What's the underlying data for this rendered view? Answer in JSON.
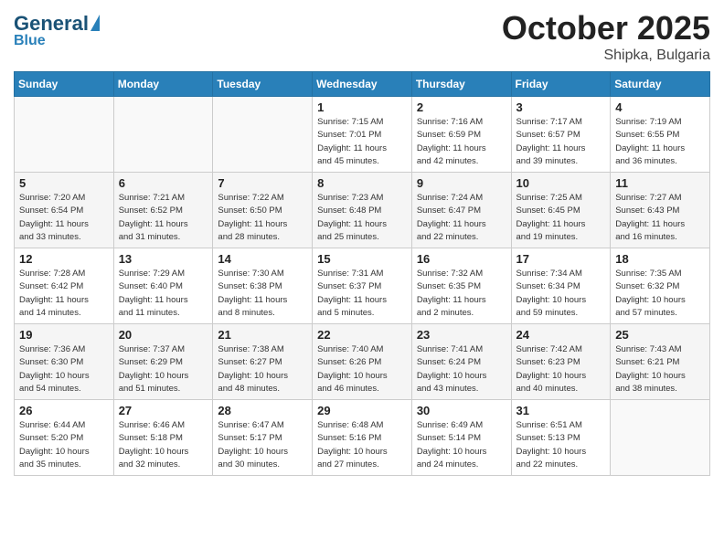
{
  "header": {
    "logo_general": "General",
    "logo_blue": "Blue",
    "month_title": "October 2025",
    "subtitle": "Shipka, Bulgaria"
  },
  "days_of_week": [
    "Sunday",
    "Monday",
    "Tuesday",
    "Wednesday",
    "Thursday",
    "Friday",
    "Saturday"
  ],
  "weeks": [
    [
      {
        "day": "",
        "info": ""
      },
      {
        "day": "",
        "info": ""
      },
      {
        "day": "",
        "info": ""
      },
      {
        "day": "1",
        "info": "Sunrise: 7:15 AM\nSunset: 7:01 PM\nDaylight: 11 hours\nand 45 minutes."
      },
      {
        "day": "2",
        "info": "Sunrise: 7:16 AM\nSunset: 6:59 PM\nDaylight: 11 hours\nand 42 minutes."
      },
      {
        "day": "3",
        "info": "Sunrise: 7:17 AM\nSunset: 6:57 PM\nDaylight: 11 hours\nand 39 minutes."
      },
      {
        "day": "4",
        "info": "Sunrise: 7:19 AM\nSunset: 6:55 PM\nDaylight: 11 hours\nand 36 minutes."
      }
    ],
    [
      {
        "day": "5",
        "info": "Sunrise: 7:20 AM\nSunset: 6:54 PM\nDaylight: 11 hours\nand 33 minutes."
      },
      {
        "day": "6",
        "info": "Sunrise: 7:21 AM\nSunset: 6:52 PM\nDaylight: 11 hours\nand 31 minutes."
      },
      {
        "day": "7",
        "info": "Sunrise: 7:22 AM\nSunset: 6:50 PM\nDaylight: 11 hours\nand 28 minutes."
      },
      {
        "day": "8",
        "info": "Sunrise: 7:23 AM\nSunset: 6:48 PM\nDaylight: 11 hours\nand 25 minutes."
      },
      {
        "day": "9",
        "info": "Sunrise: 7:24 AM\nSunset: 6:47 PM\nDaylight: 11 hours\nand 22 minutes."
      },
      {
        "day": "10",
        "info": "Sunrise: 7:25 AM\nSunset: 6:45 PM\nDaylight: 11 hours\nand 19 minutes."
      },
      {
        "day": "11",
        "info": "Sunrise: 7:27 AM\nSunset: 6:43 PM\nDaylight: 11 hours\nand 16 minutes."
      }
    ],
    [
      {
        "day": "12",
        "info": "Sunrise: 7:28 AM\nSunset: 6:42 PM\nDaylight: 11 hours\nand 14 minutes."
      },
      {
        "day": "13",
        "info": "Sunrise: 7:29 AM\nSunset: 6:40 PM\nDaylight: 11 hours\nand 11 minutes."
      },
      {
        "day": "14",
        "info": "Sunrise: 7:30 AM\nSunset: 6:38 PM\nDaylight: 11 hours\nand 8 minutes."
      },
      {
        "day": "15",
        "info": "Sunrise: 7:31 AM\nSunset: 6:37 PM\nDaylight: 11 hours\nand 5 minutes."
      },
      {
        "day": "16",
        "info": "Sunrise: 7:32 AM\nSunset: 6:35 PM\nDaylight: 11 hours\nand 2 minutes."
      },
      {
        "day": "17",
        "info": "Sunrise: 7:34 AM\nSunset: 6:34 PM\nDaylight: 10 hours\nand 59 minutes."
      },
      {
        "day": "18",
        "info": "Sunrise: 7:35 AM\nSunset: 6:32 PM\nDaylight: 10 hours\nand 57 minutes."
      }
    ],
    [
      {
        "day": "19",
        "info": "Sunrise: 7:36 AM\nSunset: 6:30 PM\nDaylight: 10 hours\nand 54 minutes."
      },
      {
        "day": "20",
        "info": "Sunrise: 7:37 AM\nSunset: 6:29 PM\nDaylight: 10 hours\nand 51 minutes."
      },
      {
        "day": "21",
        "info": "Sunrise: 7:38 AM\nSunset: 6:27 PM\nDaylight: 10 hours\nand 48 minutes."
      },
      {
        "day": "22",
        "info": "Sunrise: 7:40 AM\nSunset: 6:26 PM\nDaylight: 10 hours\nand 46 minutes."
      },
      {
        "day": "23",
        "info": "Sunrise: 7:41 AM\nSunset: 6:24 PM\nDaylight: 10 hours\nand 43 minutes."
      },
      {
        "day": "24",
        "info": "Sunrise: 7:42 AM\nSunset: 6:23 PM\nDaylight: 10 hours\nand 40 minutes."
      },
      {
        "day": "25",
        "info": "Sunrise: 7:43 AM\nSunset: 6:21 PM\nDaylight: 10 hours\nand 38 minutes."
      }
    ],
    [
      {
        "day": "26",
        "info": "Sunrise: 6:44 AM\nSunset: 5:20 PM\nDaylight: 10 hours\nand 35 minutes."
      },
      {
        "day": "27",
        "info": "Sunrise: 6:46 AM\nSunset: 5:18 PM\nDaylight: 10 hours\nand 32 minutes."
      },
      {
        "day": "28",
        "info": "Sunrise: 6:47 AM\nSunset: 5:17 PM\nDaylight: 10 hours\nand 30 minutes."
      },
      {
        "day": "29",
        "info": "Sunrise: 6:48 AM\nSunset: 5:16 PM\nDaylight: 10 hours\nand 27 minutes."
      },
      {
        "day": "30",
        "info": "Sunrise: 6:49 AM\nSunset: 5:14 PM\nDaylight: 10 hours\nand 24 minutes."
      },
      {
        "day": "31",
        "info": "Sunrise: 6:51 AM\nSunset: 5:13 PM\nDaylight: 10 hours\nand 22 minutes."
      },
      {
        "day": "",
        "info": ""
      }
    ]
  ]
}
